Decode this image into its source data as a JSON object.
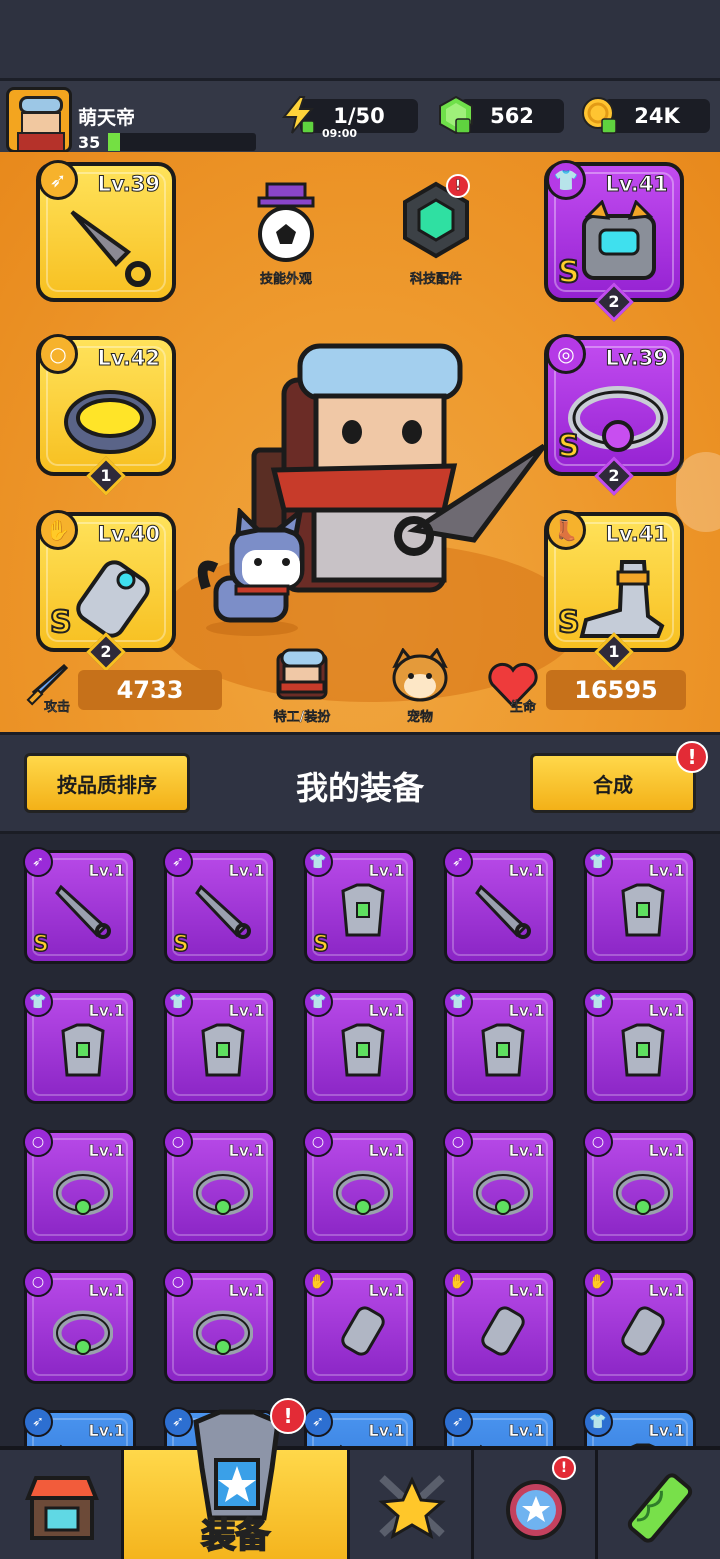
{
  "player": {
    "name": "萌天帝",
    "level": "35",
    "exp_fraction": 0.08
  },
  "resources": {
    "energy": "1/50",
    "energy_timer": "09:00",
    "gems": "562",
    "coins": "24K"
  },
  "features": {
    "skill_skin": "技能外观",
    "tech_parts": "科技配件",
    "agent_outfit": "特工/装扮",
    "pet": "宠物"
  },
  "stats": {
    "attack_label": "攻击",
    "attack": "4733",
    "hp_label": "生命",
    "hp": "16595"
  },
  "equipped": [
    {
      "slot": "weapon",
      "level": "Lv.39",
      "rank": "",
      "stars": ""
    },
    {
      "slot": "armor",
      "level": "Lv.41",
      "rank": "S",
      "stars": "2"
    },
    {
      "slot": "ring",
      "level": "Lv.42",
      "rank": "",
      "stars": "1"
    },
    {
      "slot": "necklace",
      "level": "Lv.39",
      "rank": "S",
      "stars": "2"
    },
    {
      "slot": "glove",
      "level": "Lv.40",
      "rank": "S",
      "stars": "2"
    },
    {
      "slot": "boots",
      "level": "Lv.41",
      "rank": "S",
      "stars": "1"
    }
  ],
  "panel": {
    "sort_button": "按品质排序",
    "title": "我的装备",
    "merge_button": "合成"
  },
  "inventory": {
    "level": "Lv.1",
    "rank_s": "S",
    "alert": "!"
  },
  "nav": {
    "active_label": "装备"
  },
  "colors": {
    "epic": "#a23ad9",
    "rare": "#3a84e6",
    "legendary": "#f7c021",
    "accent": "#ee9a2e"
  }
}
